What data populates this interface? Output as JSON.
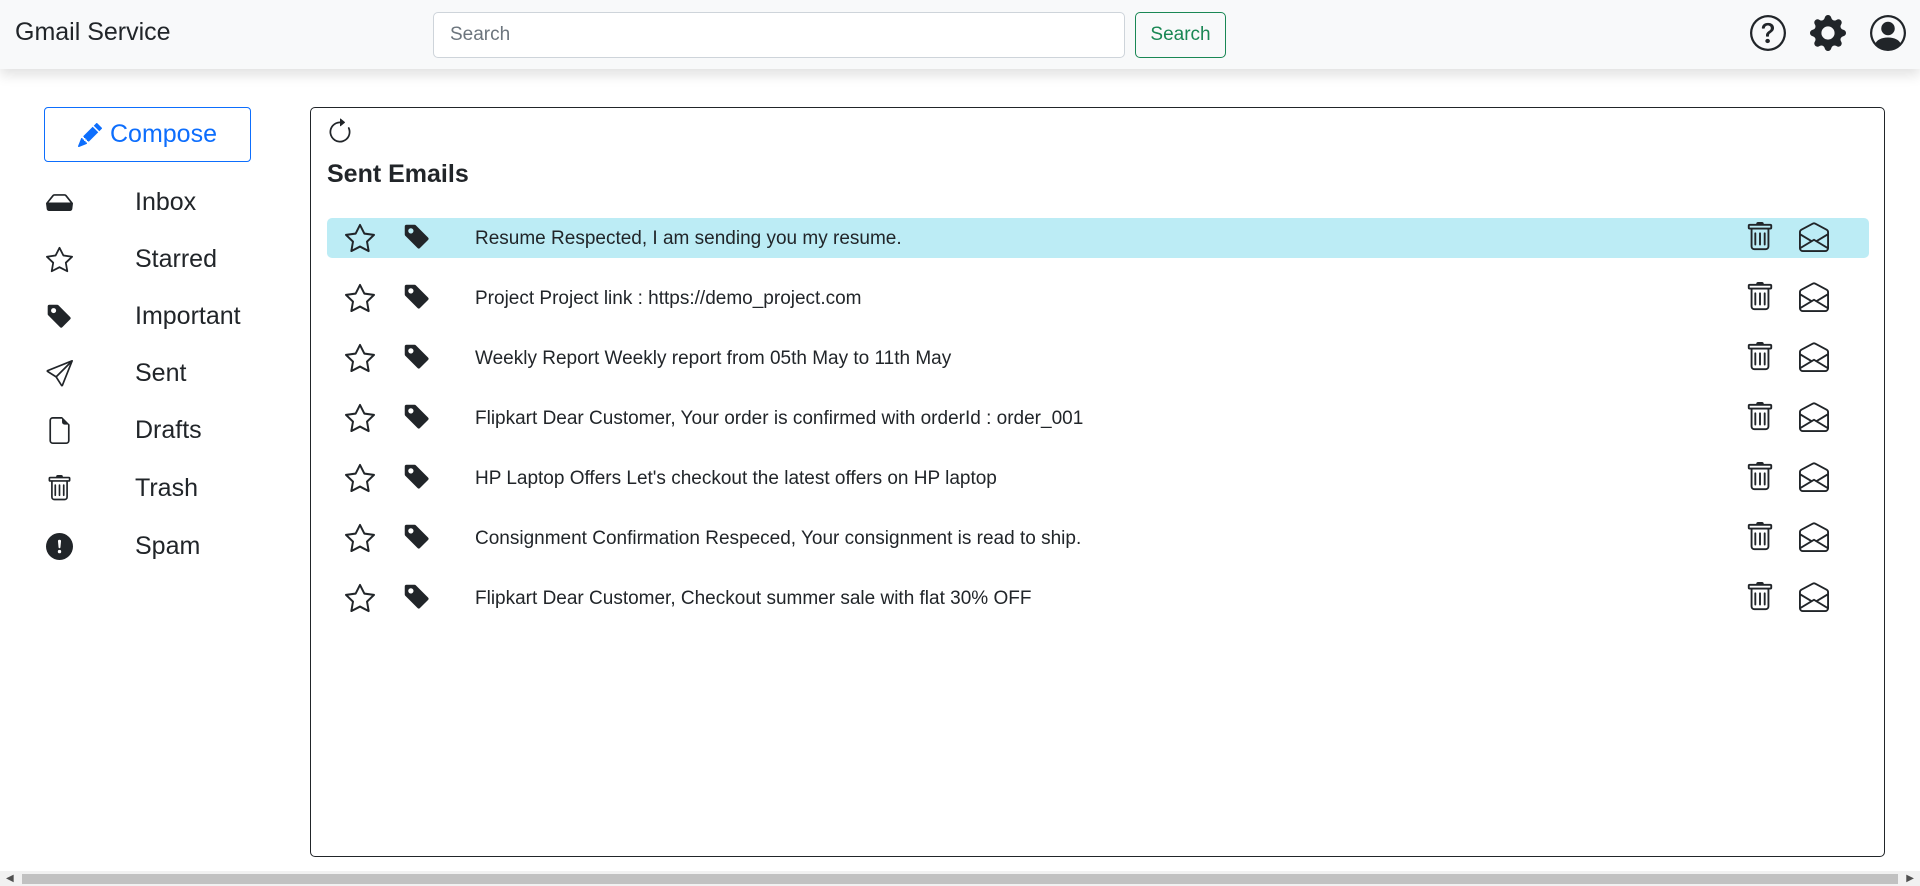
{
  "app": {
    "title": "Gmail Service"
  },
  "search": {
    "placeholder": "Search",
    "value": "",
    "button_label": "Search"
  },
  "top_icons": [
    "help-icon",
    "gear-icon",
    "user-circle-icon"
  ],
  "sidebar": {
    "compose_label": "Compose",
    "items": [
      {
        "label": "Inbox",
        "icon": "inbox-icon"
      },
      {
        "label": "Starred",
        "icon": "star-icon"
      },
      {
        "label": "Important",
        "icon": "tag-icon"
      },
      {
        "label": "Sent",
        "icon": "send-icon"
      },
      {
        "label": "Drafts",
        "icon": "file-icon"
      },
      {
        "label": "Trash",
        "icon": "trash-icon"
      },
      {
        "label": "Spam",
        "icon": "exclamation-circle-icon"
      }
    ]
  },
  "main": {
    "title": "Sent Emails",
    "emails": [
      {
        "subject": "Resume Respected, I am sending you my resume.",
        "highlighted": true
      },
      {
        "subject": "Project Project link : https://demo_project.com",
        "highlighted": false
      },
      {
        "subject": "Weekly Report Weekly report from 05th May to 11th May",
        "highlighted": false
      },
      {
        "subject": "Flipkart Dear Customer, Your order is confirmed with orderId : order_001",
        "highlighted": false
      },
      {
        "subject": "HP Laptop Offers Let's checkout the latest offers on HP laptop",
        "highlighted": false
      },
      {
        "subject": "Consignment Confirmation Respeced, Your consignment is read to ship.",
        "highlighted": false
      },
      {
        "subject": "Flipkart Dear Customer, Checkout summer sale with flat 30% OFF",
        "highlighted": false
      }
    ]
  },
  "colors": {
    "navbar_bg": "#f8f9fa",
    "primary": "#0d6efd",
    "success": "#198754",
    "highlight_row": "#bcecf5",
    "text": "#212529"
  }
}
